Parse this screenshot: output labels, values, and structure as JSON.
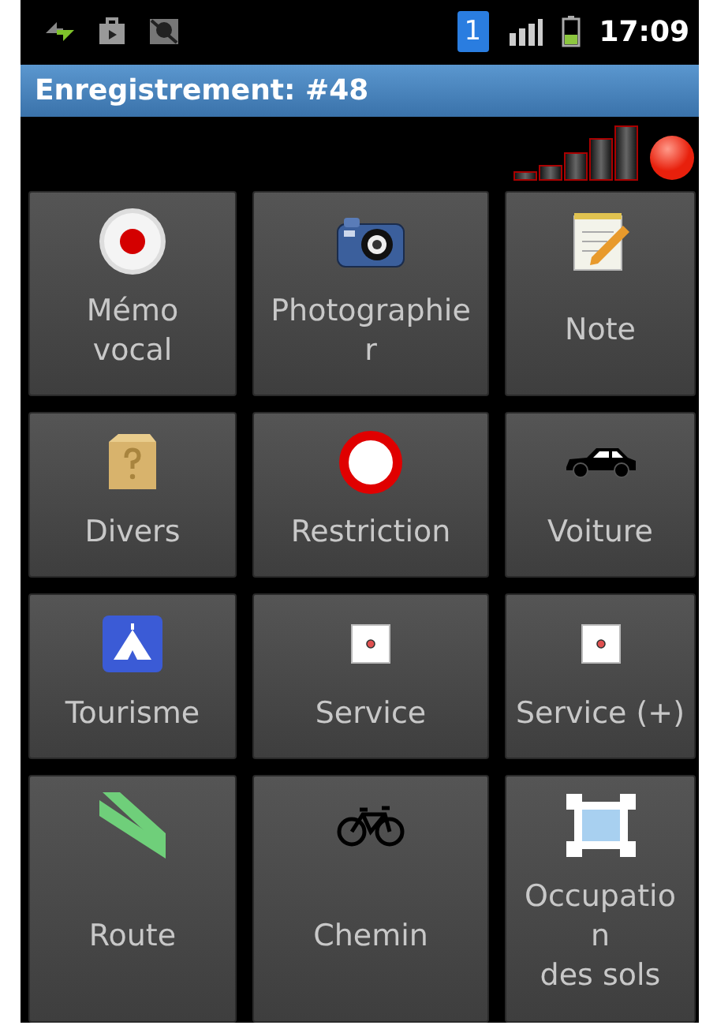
{
  "status_bar": {
    "sim": "1",
    "time": "17:09"
  },
  "title_bar": {
    "title": "Enregistrement: #48"
  },
  "tiles": [
    {
      "kind": "record",
      "label": "Mémo\nvocal"
    },
    {
      "kind": "camera",
      "label": "Photographie\nr"
    },
    {
      "kind": "notepad",
      "label": "Note"
    },
    {
      "kind": "box",
      "label": "Divers"
    },
    {
      "kind": "ring",
      "label": "Restriction"
    },
    {
      "kind": "car",
      "label": "Voiture"
    },
    {
      "kind": "tent",
      "label": "Tourisme"
    },
    {
      "kind": "dot",
      "label": "Service"
    },
    {
      "kind": "dot",
      "label": "Service (+)"
    },
    {
      "kind": "stripes",
      "label": "Route"
    },
    {
      "kind": "bicycle",
      "label": "Chemin"
    },
    {
      "kind": "area",
      "label": "Occupatio\nn\ndes sols"
    }
  ]
}
